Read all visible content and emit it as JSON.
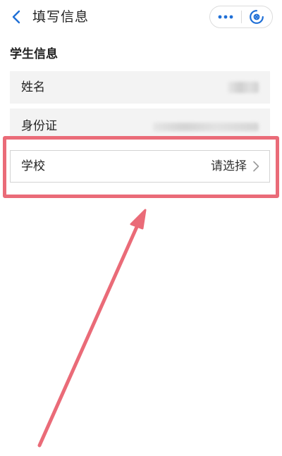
{
  "nav": {
    "title": "填写信息",
    "back_icon": "chevron-left-icon",
    "more_icon": "more-dots-icon",
    "close_icon": "close-circle-icon"
  },
  "section": {
    "title": "学生信息"
  },
  "form": {
    "name_label": "姓名",
    "id_label": "身份证",
    "school_label": "学校",
    "school_placeholder": "请选择"
  },
  "colors": {
    "accent": "#1f6fd6",
    "annotation": "#ea6b78",
    "row_background": "#f3f3f3"
  }
}
